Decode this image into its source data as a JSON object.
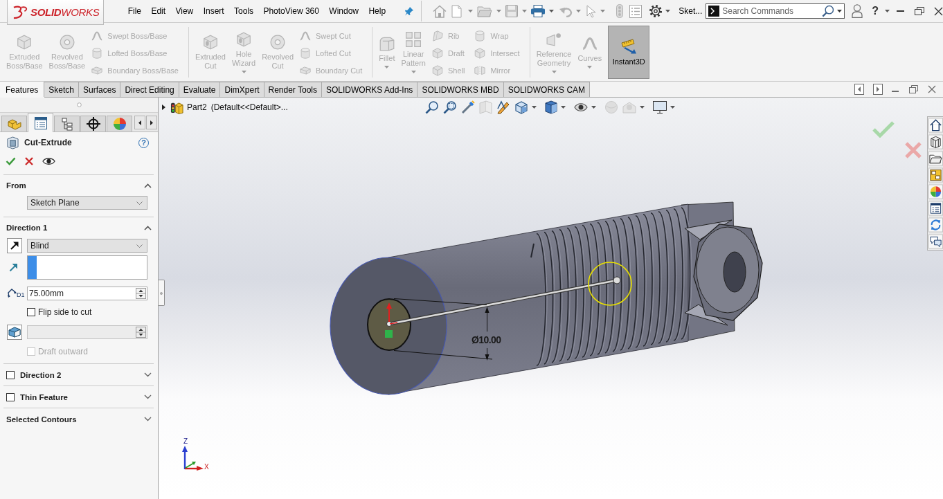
{
  "title_bar": {
    "logo": "**SOLID**WORKS",
    "menu": [
      "File",
      "Edit",
      "View",
      "Insert",
      "Tools",
      "PhotoView 360",
      "Window",
      "Help"
    ],
    "document_name": "Sket...",
    "search": {
      "placeholder": "Search Commands"
    },
    "help_button": "?"
  },
  "ribbon": {
    "groups": [
      {
        "items": [
          {
            "kind": "large",
            "label": "Extruded Boss/Base",
            "disabled": true,
            "dropdown": false
          },
          {
            "kind": "large",
            "label": "Revolved Boss/Base",
            "disabled": true,
            "dropdown": false
          },
          {
            "kind": "stack",
            "entries": [
              {
                "label": "Swept Boss/Base",
                "disabled": true
              },
              {
                "label": "Lofted Boss/Base",
                "disabled": true
              },
              {
                "label": "Boundary Boss/Base",
                "disabled": true
              }
            ]
          }
        ]
      },
      {
        "items": [
          {
            "kind": "large",
            "label": "Extruded Cut",
            "disabled": true,
            "dropdown": false
          },
          {
            "kind": "large",
            "label": "Hole Wizard",
            "disabled": true,
            "dropdown": true
          },
          {
            "kind": "large",
            "label": "Revolved Cut",
            "disabled": true,
            "dropdown": false
          },
          {
            "kind": "stack",
            "entries": [
              {
                "label": "Swept Cut",
                "disabled": true
              },
              {
                "label": "Lofted Cut",
                "disabled": true
              },
              {
                "label": "Boundary Cut",
                "disabled": true
              }
            ]
          }
        ]
      },
      {
        "items": [
          {
            "kind": "large",
            "label": "Fillet",
            "disabled": true,
            "dropdown": true
          },
          {
            "kind": "large",
            "label": "Linear Pattern",
            "disabled": true,
            "dropdown": true
          },
          {
            "kind": "stack",
            "entries": [
              {
                "label": "Rib",
                "disabled": true
              },
              {
                "label": "Draft",
                "disabled": true
              },
              {
                "label": "Shell",
                "disabled": true
              }
            ]
          },
          {
            "kind": "stack",
            "entries": [
              {
                "label": "Wrap",
                "disabled": true
              },
              {
                "label": "Intersect",
                "disabled": true
              },
              {
                "label": "Mirror",
                "disabled": true
              }
            ]
          }
        ]
      },
      {
        "items": [
          {
            "kind": "large",
            "label": "Reference Geometry",
            "disabled": true,
            "dropdown": true
          },
          {
            "kind": "large",
            "label": "Curves",
            "disabled": true,
            "dropdown": true
          }
        ]
      }
    ],
    "instant3d": {
      "label": "Instant3D",
      "on": true
    }
  },
  "tabs": [
    {
      "label": "Features",
      "selected": true
    },
    {
      "label": "Sketch",
      "selected": false
    },
    {
      "label": "Surfaces",
      "selected": false
    },
    {
      "label": "Direct Editing",
      "selected": false
    },
    {
      "label": "Evaluate",
      "selected": false
    },
    {
      "label": "DimXpert",
      "selected": false
    },
    {
      "label": "Render Tools",
      "selected": false
    },
    {
      "label": "SOLIDWORKS Add-Ins",
      "selected": false
    },
    {
      "label": "SOLIDWORKS MBD",
      "selected": false
    },
    {
      "label": "SOLIDWORKS CAM",
      "selected": false
    }
  ],
  "property_manager": {
    "panel_tabs": [
      {
        "selected": false
      },
      {
        "selected": true
      },
      {
        "selected": false
      },
      {
        "selected": false
      },
      {
        "selected": false
      }
    ],
    "title": "Cut-Extrude",
    "help_button": "?",
    "sections": [
      {
        "kind": "plain",
        "title": "From",
        "expanded": true,
        "controls": [
          {
            "kind": "dropdown",
            "value": "Sketch Plane",
            "disabled": false
          }
        ]
      },
      {
        "kind": "plain",
        "title": "Direction 1",
        "expanded": true,
        "controls": [
          {
            "kind": "direction",
            "value": "Blind",
            "disabled": false
          },
          {
            "kind": "selection",
            "active": true
          },
          {
            "kind": "depth",
            "symbol": "D1",
            "value": "75.00mm",
            "disabled": false
          },
          {
            "kind": "checkbox",
            "label": "Flip side to cut",
            "checked": false,
            "disabled": false
          },
          {
            "kind": "draft",
            "disabled": true
          },
          {
            "kind": "checkbox",
            "label": "Draft outward",
            "checked": false,
            "disabled": true
          }
        ]
      },
      {
        "kind": "checkable",
        "title": "Direction 2",
        "checked": false,
        "expanded": false
      },
      {
        "kind": "checkable",
        "title": "Thin Feature",
        "checked": false,
        "expanded": false
      },
      {
        "kind": "plain",
        "title": "Selected Contours",
        "expanded": false
      }
    ]
  },
  "viewport": {
    "tree_flyout": {
      "name": "Part2",
      "configuration": "(Default<<Default>...",
      "expanded": false
    },
    "dimension": "Ø10.00",
    "triad": {
      "z_label": "Z",
      "x_label": "X"
    }
  }
}
